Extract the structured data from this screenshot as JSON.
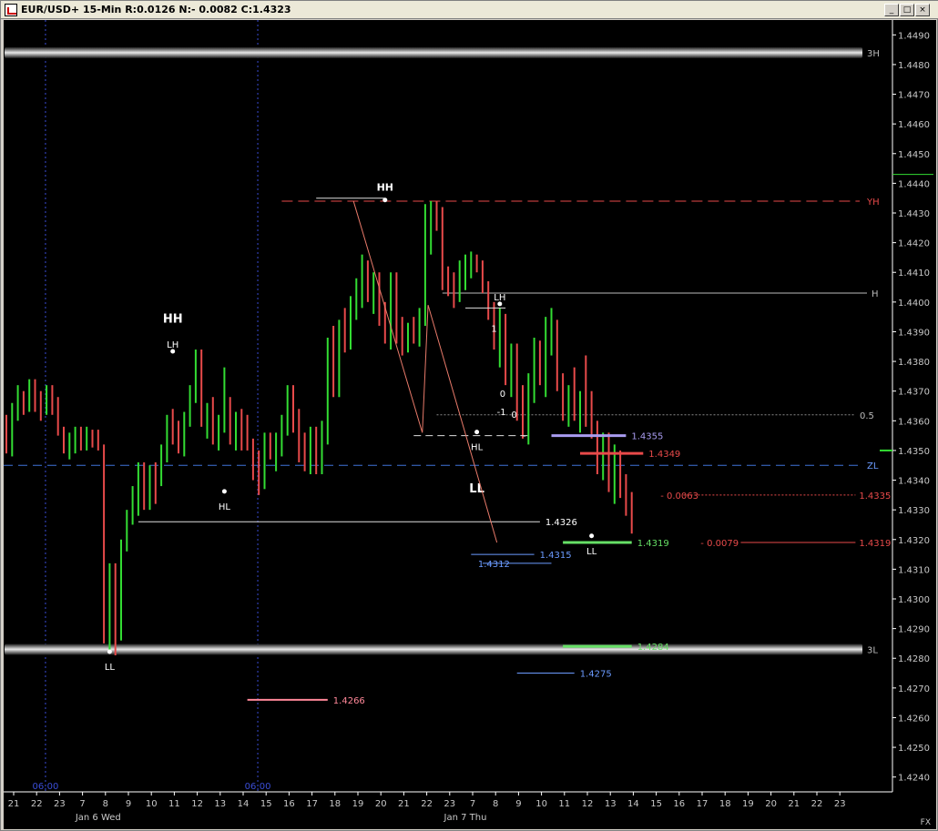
{
  "window": {
    "title": "EUR/USD+ 15-Min R:0.0126 N:- 0.0082 C:1.4323",
    "controls": [
      "_",
      "□",
      "×"
    ]
  },
  "colors": {
    "background": "#000000",
    "bull": "#33dd33",
    "bear": "#e84a4a",
    "grid": "#3a4dd6",
    "axis_text": "#c8c8c8",
    "annot_blue": "#6b9bff",
    "annot_purple": "#a99cf0",
    "annot_green": "#66e066",
    "annot_pink": "#ff8899"
  },
  "chart_data": {
    "type": "bar",
    "symbol": "EUR/USD+",
    "timeframe": "15-Min",
    "ylim": [
      1.4235,
      1.4495
    ],
    "y_ticks": [
      "1.4490",
      "1.4480",
      "1.4470",
      "1.4460",
      "1.4450",
      "1.4440",
      "1.4430",
      "1.4420",
      "1.4410",
      "1.4400",
      "1.4390",
      "1.4380",
      "1.4370",
      "1.4360",
      "1.4350",
      "1.4340",
      "1.4330",
      "1.4320",
      "1.4310",
      "1.4300",
      "1.4290",
      "1.4280",
      "1.4270",
      "1.4260",
      "1.4250",
      "1.4240"
    ],
    "x_ticks": [
      "21",
      "22",
      "23",
      "7",
      "8",
      "9",
      "10",
      "11",
      "12",
      "13",
      "14",
      "15",
      "16",
      "17",
      "18",
      "19",
      "20",
      "21",
      "22",
      "23",
      "7",
      "8",
      "9",
      "10",
      "11",
      "12",
      "13",
      "14",
      "15",
      "16",
      "17",
      "18",
      "19",
      "20",
      "21",
      "22",
      "23"
    ],
    "date_labels": [
      "Jan 6 Wed",
      "Jan 7 Thu"
    ],
    "session_labels": [
      "06:00",
      "06:00"
    ],
    "corner_label": "FX",
    "bars": [
      [
        1.436,
        1.4362,
        1.4349,
        1.4351
      ],
      [
        1.4351,
        1.4366,
        1.4348,
        1.4364
      ],
      [
        1.4364,
        1.4372,
        1.436,
        1.4368
      ],
      [
        1.4368,
        1.437,
        1.4362,
        1.4365
      ],
      [
        1.4365,
        1.4374,
        1.4363,
        1.4372
      ],
      [
        1.4372,
        1.4374,
        1.4363,
        1.4366
      ],
      [
        1.4366,
        1.437,
        1.436,
        1.4364
      ],
      [
        1.4364,
        1.4372,
        1.4362,
        1.437
      ],
      [
        1.437,
        1.4372,
        1.4362,
        1.4366
      ],
      [
        1.4366,
        1.4368,
        1.4355,
        1.4357
      ],
      [
        1.4357,
        1.4358,
        1.4349,
        1.4351
      ],
      [
        1.4351,
        1.4356,
        1.4347,
        1.4354
      ],
      [
        1.4354,
        1.4358,
        1.4349,
        1.4356
      ],
      [
        1.4356,
        1.4358,
        1.435,
        1.4352
      ],
      [
        1.4352,
        1.4358,
        1.435,
        1.4356
      ],
      [
        1.4356,
        1.4357,
        1.4351,
        1.4353
      ],
      [
        1.4353,
        1.4357,
        1.435,
        1.4351
      ],
      [
        1.4351,
        1.4352,
        1.4285,
        1.429
      ],
      [
        1.429,
        1.4312,
        1.4282,
        1.4305
      ],
      [
        1.4305,
        1.4312,
        1.4281,
        1.4287
      ],
      [
        1.4287,
        1.432,
        1.4286,
        1.4318
      ],
      [
        1.4318,
        1.433,
        1.4316,
        1.4328
      ],
      [
        1.4328,
        1.4338,
        1.4325,
        1.4335
      ],
      [
        1.4335,
        1.4346,
        1.4328,
        1.4342
      ],
      [
        1.4342,
        1.4346,
        1.433,
        1.4334
      ],
      [
        1.4334,
        1.4345,
        1.433,
        1.4343
      ],
      [
        1.4343,
        1.4346,
        1.4332,
        1.434
      ],
      [
        1.434,
        1.4352,
        1.4338,
        1.4348
      ],
      [
        1.4348,
        1.4362,
        1.4346,
        1.436
      ],
      [
        1.436,
        1.4364,
        1.4352,
        1.4356
      ],
      [
        1.4356,
        1.436,
        1.4349,
        1.4351
      ],
      [
        1.4351,
        1.4363,
        1.4348,
        1.4362
      ],
      [
        1.4362,
        1.4372,
        1.4358,
        1.437
      ],
      [
        1.437,
        1.4384,
        1.4366,
        1.4382
      ],
      [
        1.4382,
        1.4384,
        1.4358,
        1.436
      ],
      [
        1.436,
        1.4366,
        1.4354,
        1.4364
      ],
      [
        1.4364,
        1.4368,
        1.4352,
        1.4355
      ],
      [
        1.4355,
        1.4362,
        1.435,
        1.436
      ],
      [
        1.436,
        1.4378,
        1.4356,
        1.4366
      ],
      [
        1.4366,
        1.4368,
        1.4352,
        1.4356
      ],
      [
        1.4356,
        1.4363,
        1.435,
        1.4362
      ],
      [
        1.4362,
        1.4364,
        1.435,
        1.4355
      ],
      [
        1.4355,
        1.4362,
        1.435,
        1.4352
      ],
      [
        1.4352,
        1.4354,
        1.434,
        1.4344
      ],
      [
        1.4344,
        1.435,
        1.4335,
        1.4339
      ],
      [
        1.4339,
        1.4356,
        1.4337,
        1.4354
      ],
      [
        1.4354,
        1.4356,
        1.4347,
        1.4349
      ],
      [
        1.4349,
        1.4356,
        1.4343,
        1.4352
      ],
      [
        1.4352,
        1.4362,
        1.4348,
        1.436
      ],
      [
        1.436,
        1.4372,
        1.4355,
        1.437
      ],
      [
        1.437,
        1.4372,
        1.4356,
        1.436
      ],
      [
        1.436,
        1.4364,
        1.4346,
        1.435
      ],
      [
        1.435,
        1.4356,
        1.4343,
        1.4346
      ],
      [
        1.4346,
        1.4358,
        1.4342,
        1.4355
      ],
      [
        1.4355,
        1.4358,
        1.4342,
        1.4344
      ],
      [
        1.4344,
        1.436,
        1.4342,
        1.4358
      ],
      [
        1.4358,
        1.4388,
        1.4352,
        1.4385
      ],
      [
        1.4385,
        1.4392,
        1.4368,
        1.4372
      ],
      [
        1.4372,
        1.4394,
        1.4368,
        1.439
      ],
      [
        1.439,
        1.4398,
        1.4383,
        1.4388
      ],
      [
        1.4388,
        1.4402,
        1.4384,
        1.4398
      ],
      [
        1.4398,
        1.4408,
        1.4394,
        1.4405
      ],
      [
        1.4405,
        1.4416,
        1.4398,
        1.4412
      ],
      [
        1.4412,
        1.4414,
        1.44,
        1.4403
      ],
      [
        1.4403,
        1.441,
        1.4396,
        1.4406
      ],
      [
        1.4406,
        1.441,
        1.4392,
        1.4395
      ],
      [
        1.4395,
        1.44,
        1.4386,
        1.4388
      ],
      [
        1.4388,
        1.441,
        1.4384,
        1.4406
      ],
      [
        1.4406,
        1.441,
        1.4386,
        1.4389
      ],
      [
        1.4389,
        1.4395,
        1.4382,
        1.4385
      ],
      [
        1.4385,
        1.4393,
        1.4383,
        1.4391
      ],
      [
        1.4391,
        1.4395,
        1.4386,
        1.4389
      ],
      [
        1.4389,
        1.4398,
        1.4385,
        1.4396
      ],
      [
        1.4396,
        1.4433,
        1.4392,
        1.442
      ],
      [
        1.442,
        1.4434,
        1.4416,
        1.4432
      ],
      [
        1.4432,
        1.4434,
        1.4424,
        1.4426
      ],
      [
        1.4426,
        1.4432,
        1.4404,
        1.4408
      ],
      [
        1.4408,
        1.4412,
        1.4402,
        1.4406
      ],
      [
        1.4406,
        1.441,
        1.4398,
        1.4402
      ],
      [
        1.4402,
        1.4414,
        1.44,
        1.441
      ],
      [
        1.441,
        1.4416,
        1.4404,
        1.4412
      ],
      [
        1.4412,
        1.4417,
        1.4408,
        1.4415
      ],
      [
        1.4415,
        1.4416,
        1.441,
        1.4412
      ],
      [
        1.4412,
        1.4414,
        1.4403,
        1.4405
      ],
      [
        1.4405,
        1.4407,
        1.4394,
        1.4398
      ],
      [
        1.4398,
        1.44,
        1.4384,
        1.4388
      ],
      [
        1.4388,
        1.4398,
        1.4378,
        1.4392
      ],
      [
        1.4392,
        1.4396,
        1.4372,
        1.4376
      ],
      [
        1.4376,
        1.4386,
        1.4368,
        1.4382
      ],
      [
        1.4382,
        1.4386,
        1.436,
        1.4364
      ],
      [
        1.4364,
        1.4372,
        1.4354,
        1.4356
      ],
      [
        1.4356,
        1.4376,
        1.4352,
        1.4374
      ],
      [
        1.4374,
        1.4388,
        1.4366,
        1.4384
      ],
      [
        1.4384,
        1.4387,
        1.4372,
        1.438
      ],
      [
        1.438,
        1.4395,
        1.4368,
        1.439
      ],
      [
        1.439,
        1.4398,
        1.4382,
        1.4392
      ],
      [
        1.4392,
        1.4394,
        1.437,
        1.4372
      ],
      [
        1.4372,
        1.4376,
        1.436,
        1.4364
      ],
      [
        1.4364,
        1.4372,
        1.4358,
        1.4368
      ],
      [
        1.4368,
        1.4378,
        1.436,
        1.4362
      ],
      [
        1.4362,
        1.437,
        1.4356,
        1.4368
      ],
      [
        1.4368,
        1.4382,
        1.4358,
        1.4366
      ],
      [
        1.4366,
        1.437,
        1.4354,
        1.4356
      ],
      [
        1.4356,
        1.436,
        1.4342,
        1.4346
      ],
      [
        1.4346,
        1.4356,
        1.434,
        1.4352
      ],
      [
        1.4352,
        1.4356,
        1.4336,
        1.434
      ],
      [
        1.434,
        1.4352,
        1.4332,
        1.4348
      ],
      [
        1.4348,
        1.435,
        1.4334,
        1.4336
      ],
      [
        1.4336,
        1.4342,
        1.4328,
        1.4332
      ],
      [
        1.4332,
        1.4336,
        1.4322,
        1.4325
      ]
    ],
    "session_separators": [
      6.5,
      43.5
    ],
    "horizontal_levels": [
      {
        "label": "3H",
        "value": 1.4484,
        "style": "band"
      },
      {
        "label": "YH",
        "value": 1.4434,
        "style": "dashed-red"
      },
      {
        "label": "H",
        "value": 1.4403,
        "style": "solid-white"
      },
      {
        "label": "0.5",
        "value": 1.4362,
        "style": "dotted-gray"
      },
      {
        "label": "ZL",
        "value": 1.4345,
        "style": "dashed-blue"
      },
      {
        "label": "3L",
        "value": 1.4283,
        "style": "band"
      }
    ],
    "level_labels": [
      {
        "text": "1.4355",
        "value": 1.4355,
        "color": "#a99cf0"
      },
      {
        "text": "1.4349",
        "value": 1.4349,
        "color": "#e84a4a"
      },
      {
        "text": "1.4335",
        "value": 1.4335,
        "color": "#e84a4a"
      },
      {
        "text": "- 0.0063",
        "value": 1.4335,
        "color": "#e84a4a"
      },
      {
        "text": "1.4326",
        "value": 1.4326,
        "color": "#ffffff"
      },
      {
        "text": "1.4319",
        "value": 1.4319,
        "color": "#66e066"
      },
      {
        "text": "- 0.0079",
        "value": 1.4319,
        "color": "#e84a4a"
      },
      {
        "text": "1.4319",
        "value": 1.4319,
        "color": "#e84a4a"
      },
      {
        "text": "1.4315",
        "value": 1.4315,
        "color": "#6b9bff"
      },
      {
        "text": "1.4312",
        "value": 1.4312,
        "color": "#6b9bff"
      },
      {
        "text": "1.4284",
        "value": 1.4284,
        "color": "#66e066"
      },
      {
        "text": "1.4275",
        "value": 1.4275,
        "color": "#6b9bff"
      },
      {
        "text": "1.4266",
        "value": 1.4266,
        "color": "#ff8899"
      }
    ],
    "swing_labels": [
      {
        "text": "HH",
        "price": 1.4435
      },
      {
        "text": "HH",
        "price": 1.439
      },
      {
        "text": "LH",
        "price": 1.4384
      },
      {
        "text": "HL",
        "price": 1.4335
      },
      {
        "text": "LH",
        "price": 1.44
      },
      {
        "text": "HL",
        "price": 1.4355
      },
      {
        "text": "LL",
        "price": 1.4345
      },
      {
        "text": "LL",
        "price": 1.4281
      },
      {
        "text": "LL",
        "price": 1.432
      }
    ],
    "inline_labels": [
      "1",
      "0",
      "-1",
      "0",
      "-"
    ],
    "projection": [
      {
        "x": 60.5,
        "y": 1.4434
      },
      {
        "x": 72.5,
        "y": 1.4356
      },
      {
        "x": 73.5,
        "y": 1.4399
      },
      {
        "x": 85.5,
        "y": 1.4319
      }
    ]
  }
}
